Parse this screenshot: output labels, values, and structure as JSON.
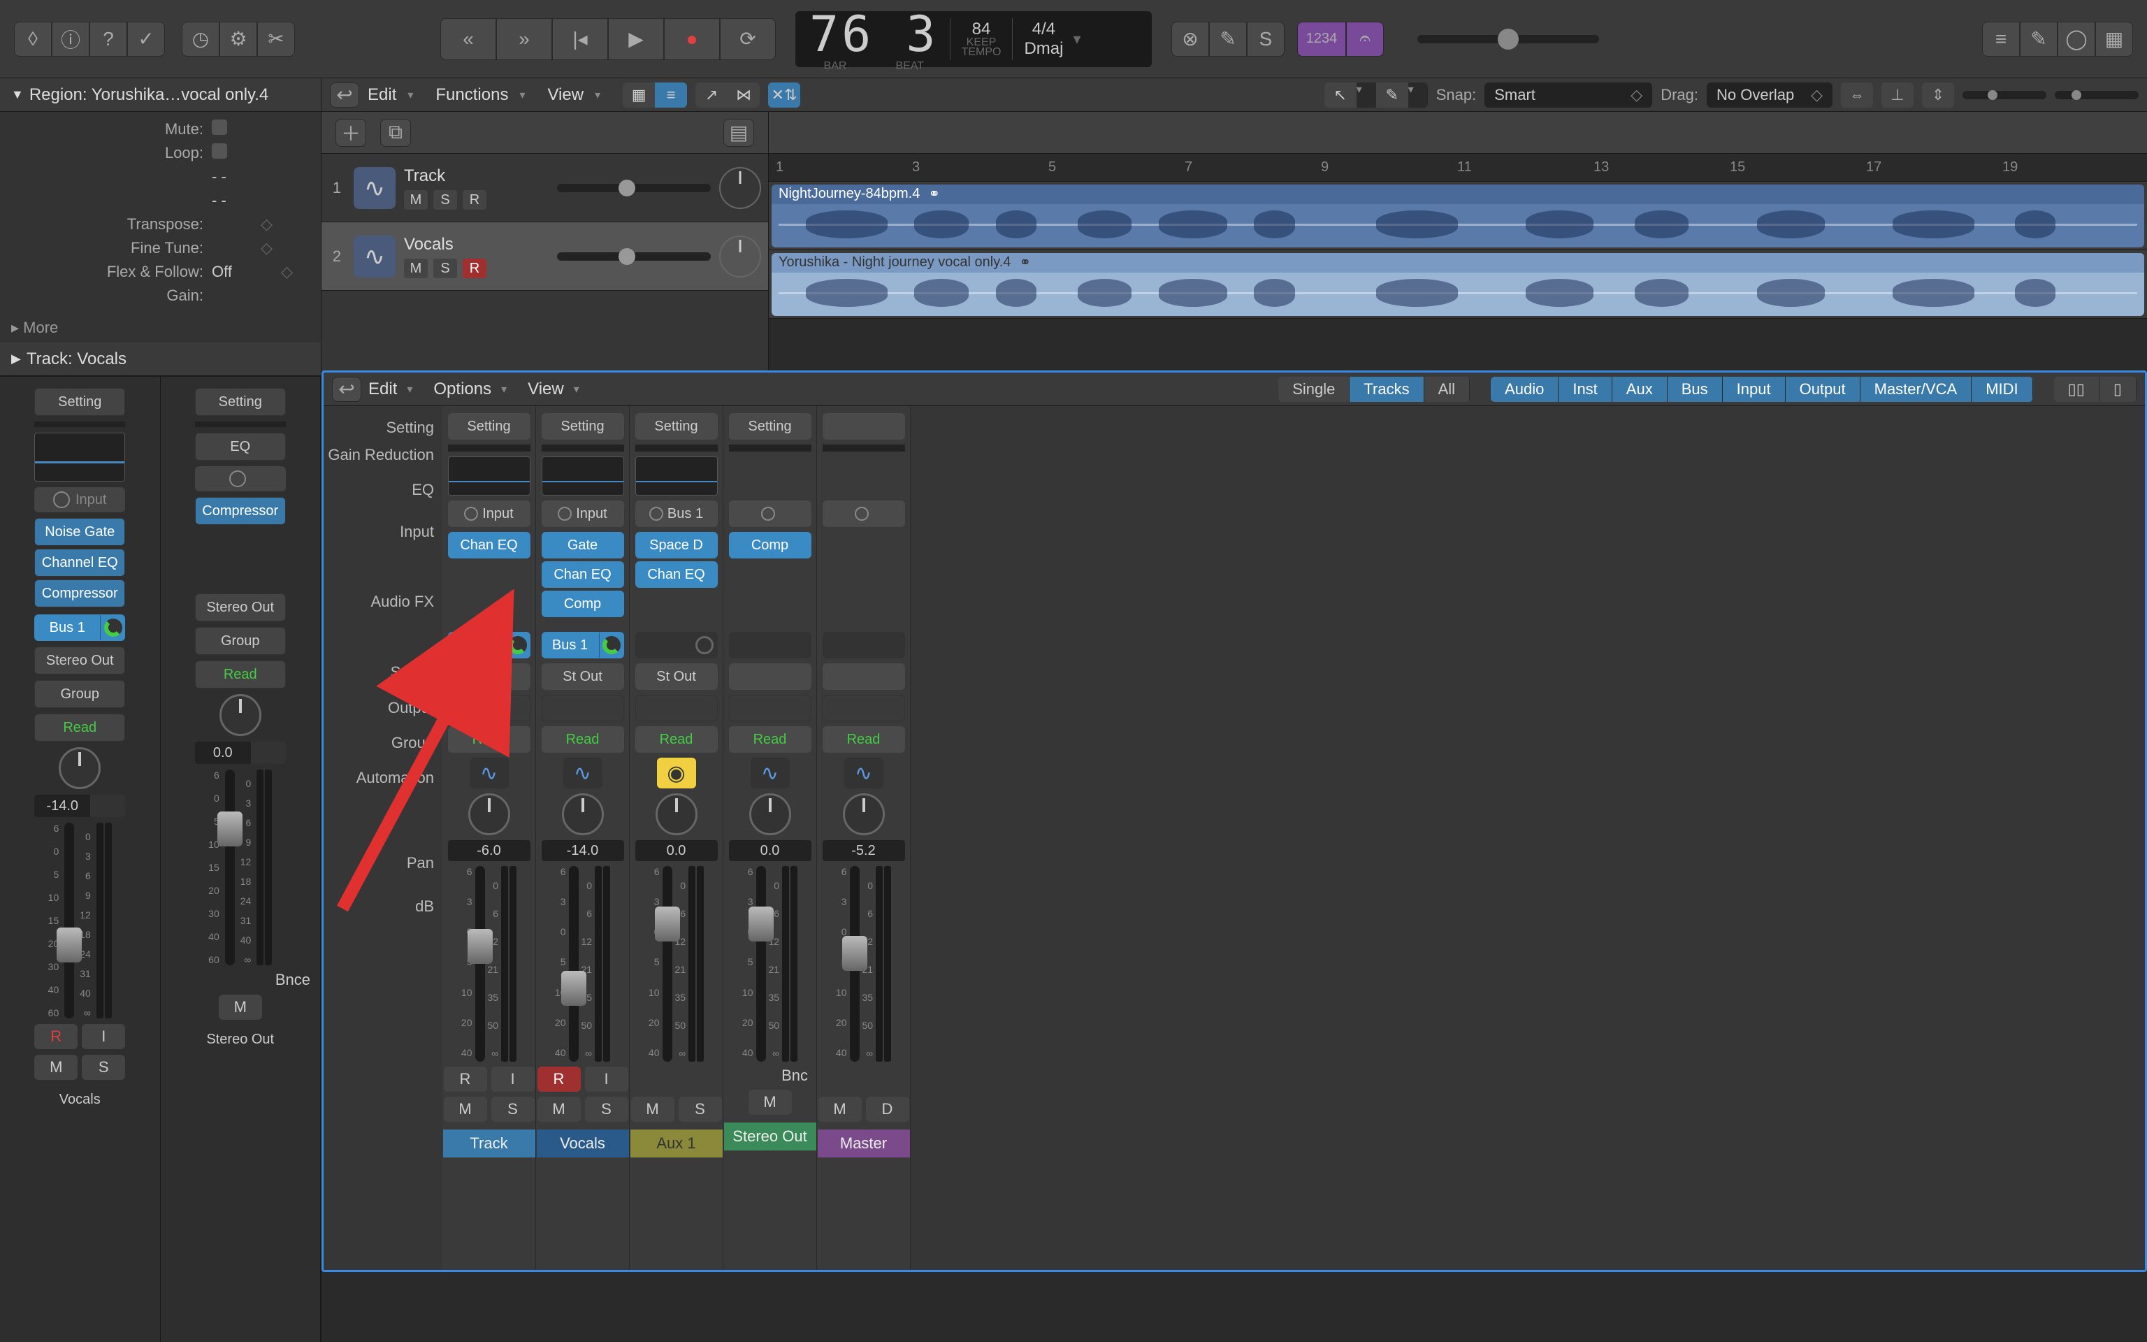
{
  "toolbar": {
    "icons": [
      "file-icon",
      "info-icon",
      "help-icon",
      "done-icon",
      "metronome-icon",
      "sliders-icon",
      "scissors-icon"
    ],
    "transport": [
      "rewind",
      "forward",
      "back",
      "play",
      "record",
      "cycle"
    ]
  },
  "lcd": {
    "bar": "76 3",
    "bar_label": "BAR",
    "beat_label": "BEAT",
    "tempo": "84",
    "tempo_keep": "KEEP",
    "tempo_label": "TEMPO",
    "sig": "4/4",
    "key": "Dmaj"
  },
  "top_right": [
    "x-btn",
    "wand",
    "s-btn",
    "1234",
    "glyph"
  ],
  "region_panel": {
    "title": "Region: Yorushika…vocal only.4",
    "rows": [
      {
        "label": "Mute:",
        "val": ""
      },
      {
        "label": "Loop:",
        "val": ""
      },
      {
        "label": "",
        "val": "-  -"
      },
      {
        "label": "",
        "val": "-  -"
      },
      {
        "label": "Transpose:",
        "val": ""
      },
      {
        "label": "Fine Tune:",
        "val": ""
      },
      {
        "label": "Flex & Follow:",
        "val": "Off"
      },
      {
        "label": "Gain:",
        "val": ""
      }
    ],
    "more": "More"
  },
  "track_panel": {
    "title": "Track:  Vocals"
  },
  "left_channels": [
    {
      "setting": "Setting",
      "eq": true,
      "input_label": "Input",
      "fx": [
        "Noise Gate",
        "Channel EQ",
        "Compressor"
      ],
      "send": "Bus 1",
      "out": "Stereo Out",
      "group": "Group",
      "read": "Read",
      "db": "-14.0",
      "faderTop": 150,
      "ri": [
        "R",
        "I"
      ],
      "ms": [
        "M",
        "S"
      ],
      "name": "Vocals"
    },
    {
      "setting": "Setting",
      "eq": false,
      "eq_label": "EQ",
      "input_label": "",
      "fx": [
        "Compressor"
      ],
      "out": "Stereo Out",
      "group": "Group",
      "read": "Read",
      "db": "0.0",
      "faderTop": 60,
      "bnce": "Bnce",
      "ms": [
        "M"
      ],
      "name": "Stereo Out"
    }
  ],
  "arrange": {
    "menus": [
      "Edit",
      "Functions",
      "View"
    ],
    "snap_label": "Snap:",
    "snap": "Smart",
    "drag_label": "Drag:",
    "drag": "No Overlap",
    "tracks": [
      {
        "num": "1",
        "name": "Track",
        "btns": [
          "M",
          "S",
          "R"
        ],
        "sel": false
      },
      {
        "num": "2",
        "name": "Vocals",
        "btns": [
          "M",
          "S",
          "R"
        ],
        "sel": true
      }
    ],
    "ruler": [
      1,
      3,
      5,
      7,
      9,
      11,
      13,
      15,
      17,
      19
    ],
    "regions": [
      {
        "name": "NightJourney-84bpm.4",
        "light": false
      },
      {
        "name": "Yorushika - Night journey vocal only.4",
        "light": true
      }
    ]
  },
  "mixer": {
    "menus": [
      "Edit",
      "Options",
      "View"
    ],
    "view_tabs": [
      "Single",
      "Tracks",
      "All"
    ],
    "filter_tabs": [
      "Audio",
      "Inst",
      "Aux",
      "Bus",
      "Input",
      "Output",
      "Master/VCA",
      "MIDI"
    ],
    "row_labels": [
      "Setting",
      "Gain Reduction",
      "EQ",
      "Input",
      "Audio FX",
      "Sends",
      "Output",
      "Group",
      "Automation",
      "Pan",
      "dB"
    ],
    "strips": [
      {
        "setting": "Setting",
        "input": "Input",
        "fx": [
          "Chan EQ"
        ],
        "send": "Bus 1",
        "out": "St Out",
        "read": "Read",
        "db": "-6.0",
        "ri": [
          "R",
          "I"
        ],
        "ms": [
          "M",
          "S"
        ],
        "name": "Track",
        "nameClass": "sn-blue",
        "faderTop": 90
      },
      {
        "setting": "Setting",
        "input": "Input",
        "fx": [
          "Gate",
          "Chan EQ",
          "Comp"
        ],
        "send": "Bus 1",
        "out": "St Out",
        "read": "Read",
        "db": "-14.0",
        "ri": [
          "R",
          "I"
        ],
        "ms": [
          "M",
          "S"
        ],
        "name": "Vocals",
        "nameClass": "sn-dblue",
        "faderTop": 150,
        "riR": true
      },
      {
        "setting": "Setting",
        "input": "Bus 1",
        "fx": [
          "Space D",
          "Chan EQ"
        ],
        "out": "St Out",
        "read": "Read",
        "db": "0.0",
        "ms": [
          "M",
          "S"
        ],
        "name": "Aux 1",
        "nameClass": "sn-olive",
        "faderTop": 58,
        "yellowIcon": true
      },
      {
        "setting": "Setting",
        "fx": [
          "Comp"
        ],
        "read": "Read",
        "db": "0.0",
        "ms": [
          "M"
        ],
        "name": "Stereo Out",
        "nameClass": "sn-green",
        "faderTop": 58,
        "bnc": "Bnc"
      },
      {
        "read": "Read",
        "db": "-5.2",
        "ms": [
          "M",
          "D"
        ],
        "name": "Master",
        "nameClass": "sn-purple",
        "faderTop": 100
      }
    ]
  }
}
